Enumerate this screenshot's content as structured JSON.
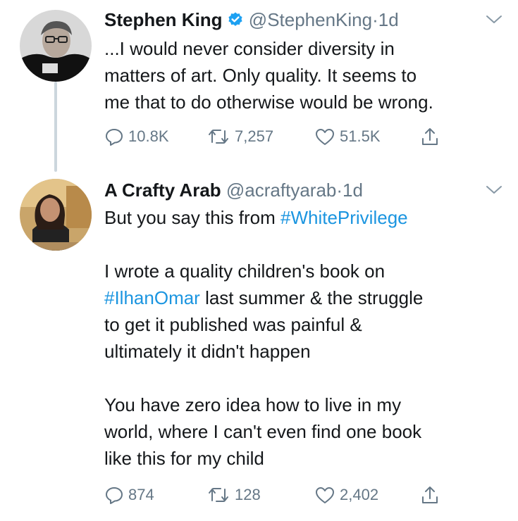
{
  "tweets": [
    {
      "name": "Stephen King",
      "handle": "@StephenKing",
      "dot": "·",
      "time": "1d",
      "verified": true,
      "lines": [
        "...I would never consider diversity in",
        "matters of art. Only quality. It seems to",
        "me that to do otherwise would be wrong."
      ],
      "replies": "10.8K",
      "retweets": "7,257",
      "likes": "51.5K"
    },
    {
      "name": "A Crafty Arab",
      "handle": "@acraftyarab",
      "dot": "·",
      "time": "1d",
      "verified": false,
      "para1_prefix": "But you say this from ",
      "para1_hashtag": "#WhitePrivilege",
      "para2_hashtag": "#IlhanOmar",
      "para2_line1_suffix": " last summer & the struggle",
      "para2_lines": [
        "I wrote a quality children's book on",
        "to get it published was painful &",
        "ultimately it didn't happen"
      ],
      "para3_lines": [
        "You have zero idea how to live in my",
        "world, where I can't even find one book",
        "like this for my child"
      ],
      "replies": "874",
      "retweets": "128",
      "likes": "2,402"
    }
  ],
  "colors": {
    "link": "#1b95e0",
    "secondary": "#657786",
    "thread_line": "#ccd6dd"
  },
  "icons": [
    "verified-badge-icon",
    "chevron-down-icon",
    "reply-icon",
    "retweet-icon",
    "like-icon",
    "share-icon"
  ]
}
